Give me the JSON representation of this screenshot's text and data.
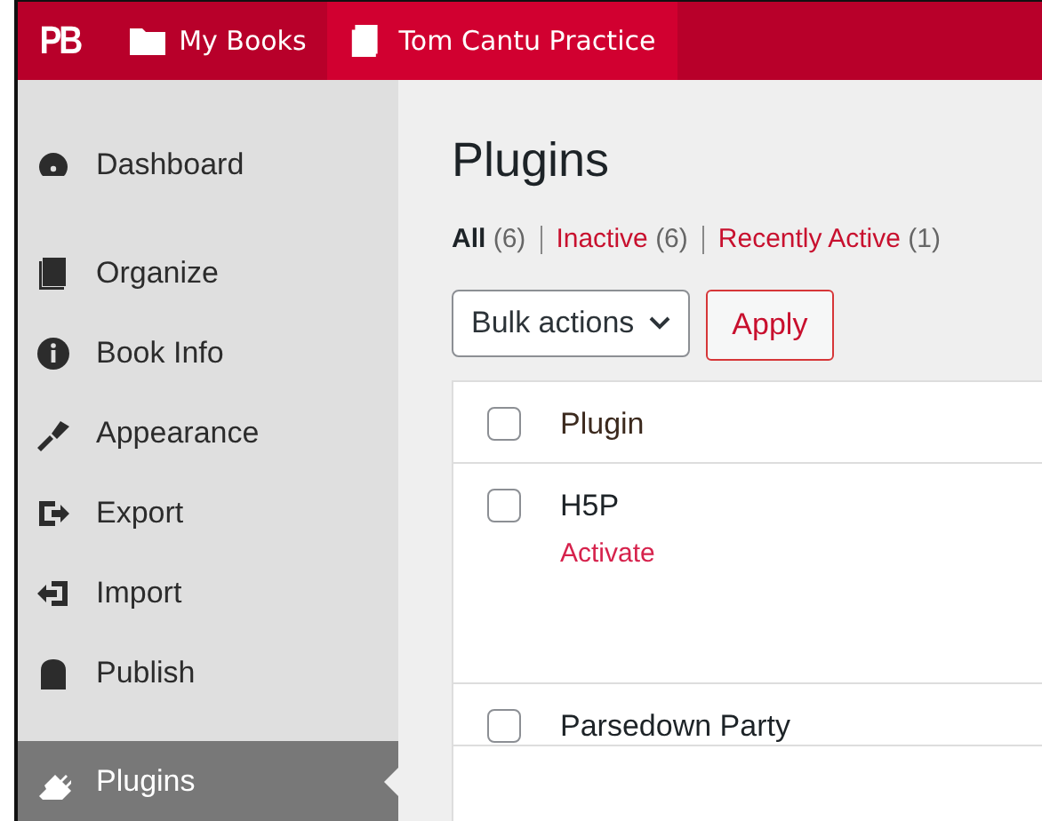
{
  "topbar": {
    "logo": "PB",
    "items": [
      {
        "label": "My Books",
        "selected": false
      },
      {
        "label": "Tom Cantu Practice",
        "selected": true
      }
    ]
  },
  "sidebar": {
    "items": [
      {
        "label": "Dashboard",
        "selected": false
      },
      {
        "label": "Organize",
        "selected": false
      },
      {
        "label": "Book Info",
        "selected": false
      },
      {
        "label": "Appearance",
        "selected": false
      },
      {
        "label": "Export",
        "selected": false
      },
      {
        "label": "Import",
        "selected": false
      },
      {
        "label": "Publish",
        "selected": false
      },
      {
        "label": "Plugins",
        "selected": true
      }
    ]
  },
  "page": {
    "title": "Plugins",
    "filters": [
      {
        "label": "All",
        "count": "(6)",
        "selected": true
      },
      {
        "label": "Inactive",
        "count": "(6)",
        "selected": false
      },
      {
        "label": "Recently Active",
        "count": "(1)",
        "selected": false
      }
    ],
    "bulk_select": {
      "value": "Bulk actions"
    },
    "apply_button": "Apply",
    "table": {
      "column_header": "Plugin",
      "header_checked": false,
      "rows": [
        {
          "name": "H5P",
          "checked": false,
          "actions": [
            "Activate"
          ]
        },
        {
          "name": "Parsedown Party",
          "checked": false,
          "actions": []
        }
      ]
    }
  }
}
